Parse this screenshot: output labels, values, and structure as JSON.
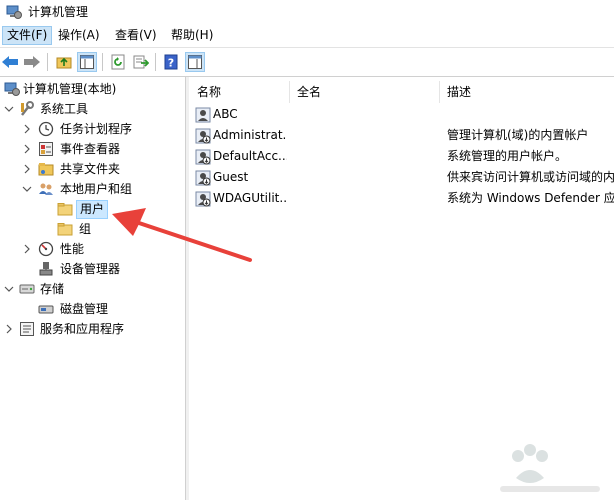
{
  "window": {
    "title": "计算机管理"
  },
  "menu": [
    {
      "label": "文件(F)",
      "active": true
    },
    {
      "label": "操作(A)",
      "active": false
    },
    {
      "label": "查看(V)",
      "active": false
    },
    {
      "label": "帮助(H)",
      "active": false
    }
  ],
  "toolbar": {
    "buttons": [
      "back-arrow-icon",
      "forward-arrow-icon",
      "up-folder-icon",
      "show-hide-tree-icon",
      "refresh-icon",
      "export-list-icon",
      "help-icon",
      "properties-icon"
    ]
  },
  "tree": [
    {
      "label": "计算机管理(本地)",
      "level": 0,
      "chevron": "none",
      "icon": "computer-management-icon"
    },
    {
      "label": "系统工具",
      "level": 1,
      "chevron": "down",
      "icon": "system-tools-icon"
    },
    {
      "label": "任务计划程序",
      "level": 2,
      "chevron": "right",
      "icon": "task-scheduler-icon"
    },
    {
      "label": "事件查看器",
      "level": 2,
      "chevron": "right",
      "icon": "event-viewer-icon"
    },
    {
      "label": "共享文件夹",
      "level": 2,
      "chevron": "right",
      "icon": "shared-folder-icon"
    },
    {
      "label": "本地用户和组",
      "level": 2,
      "chevron": "down",
      "icon": "local-users-groups-icon"
    },
    {
      "label": "用户",
      "level": 3,
      "chevron": "none",
      "icon": "folder-icon",
      "selected": true
    },
    {
      "label": "组",
      "level": 3,
      "chevron": "none",
      "icon": "folder-icon"
    },
    {
      "label": "性能",
      "level": 2,
      "chevron": "right",
      "icon": "performance-icon"
    },
    {
      "label": "设备管理器",
      "level": 2,
      "chevron": "none",
      "icon": "device-manager-icon"
    },
    {
      "label": "存储",
      "level": 1,
      "chevron": "down",
      "icon": "storage-icon"
    },
    {
      "label": "磁盘管理",
      "level": 2,
      "chevron": "none",
      "icon": "disk-management-icon"
    },
    {
      "label": "服务和应用程序",
      "level": 1,
      "chevron": "right",
      "icon": "services-apps-icon"
    }
  ],
  "list": {
    "columns": [
      "名称",
      "全名",
      "描述"
    ],
    "rows": [
      {
        "name": "ABC",
        "fullname": "",
        "description": ""
      },
      {
        "name": "Administrat...",
        "fullname": "",
        "description": "管理计算机(域)的内置帐户"
      },
      {
        "name": "DefaultAcc...",
        "fullname": "",
        "description": "系统管理的用户帐户。"
      },
      {
        "name": "Guest",
        "fullname": "",
        "description": "供来宾访问计算机或访问域的内"
      },
      {
        "name": "WDAGUtilit...",
        "fullname": "",
        "description": "系统为 Windows Defender 应"
      }
    ]
  },
  "colors": {
    "arrow": "#e8413a",
    "selection": "#cce8ff",
    "folder": "#f3d37a"
  }
}
